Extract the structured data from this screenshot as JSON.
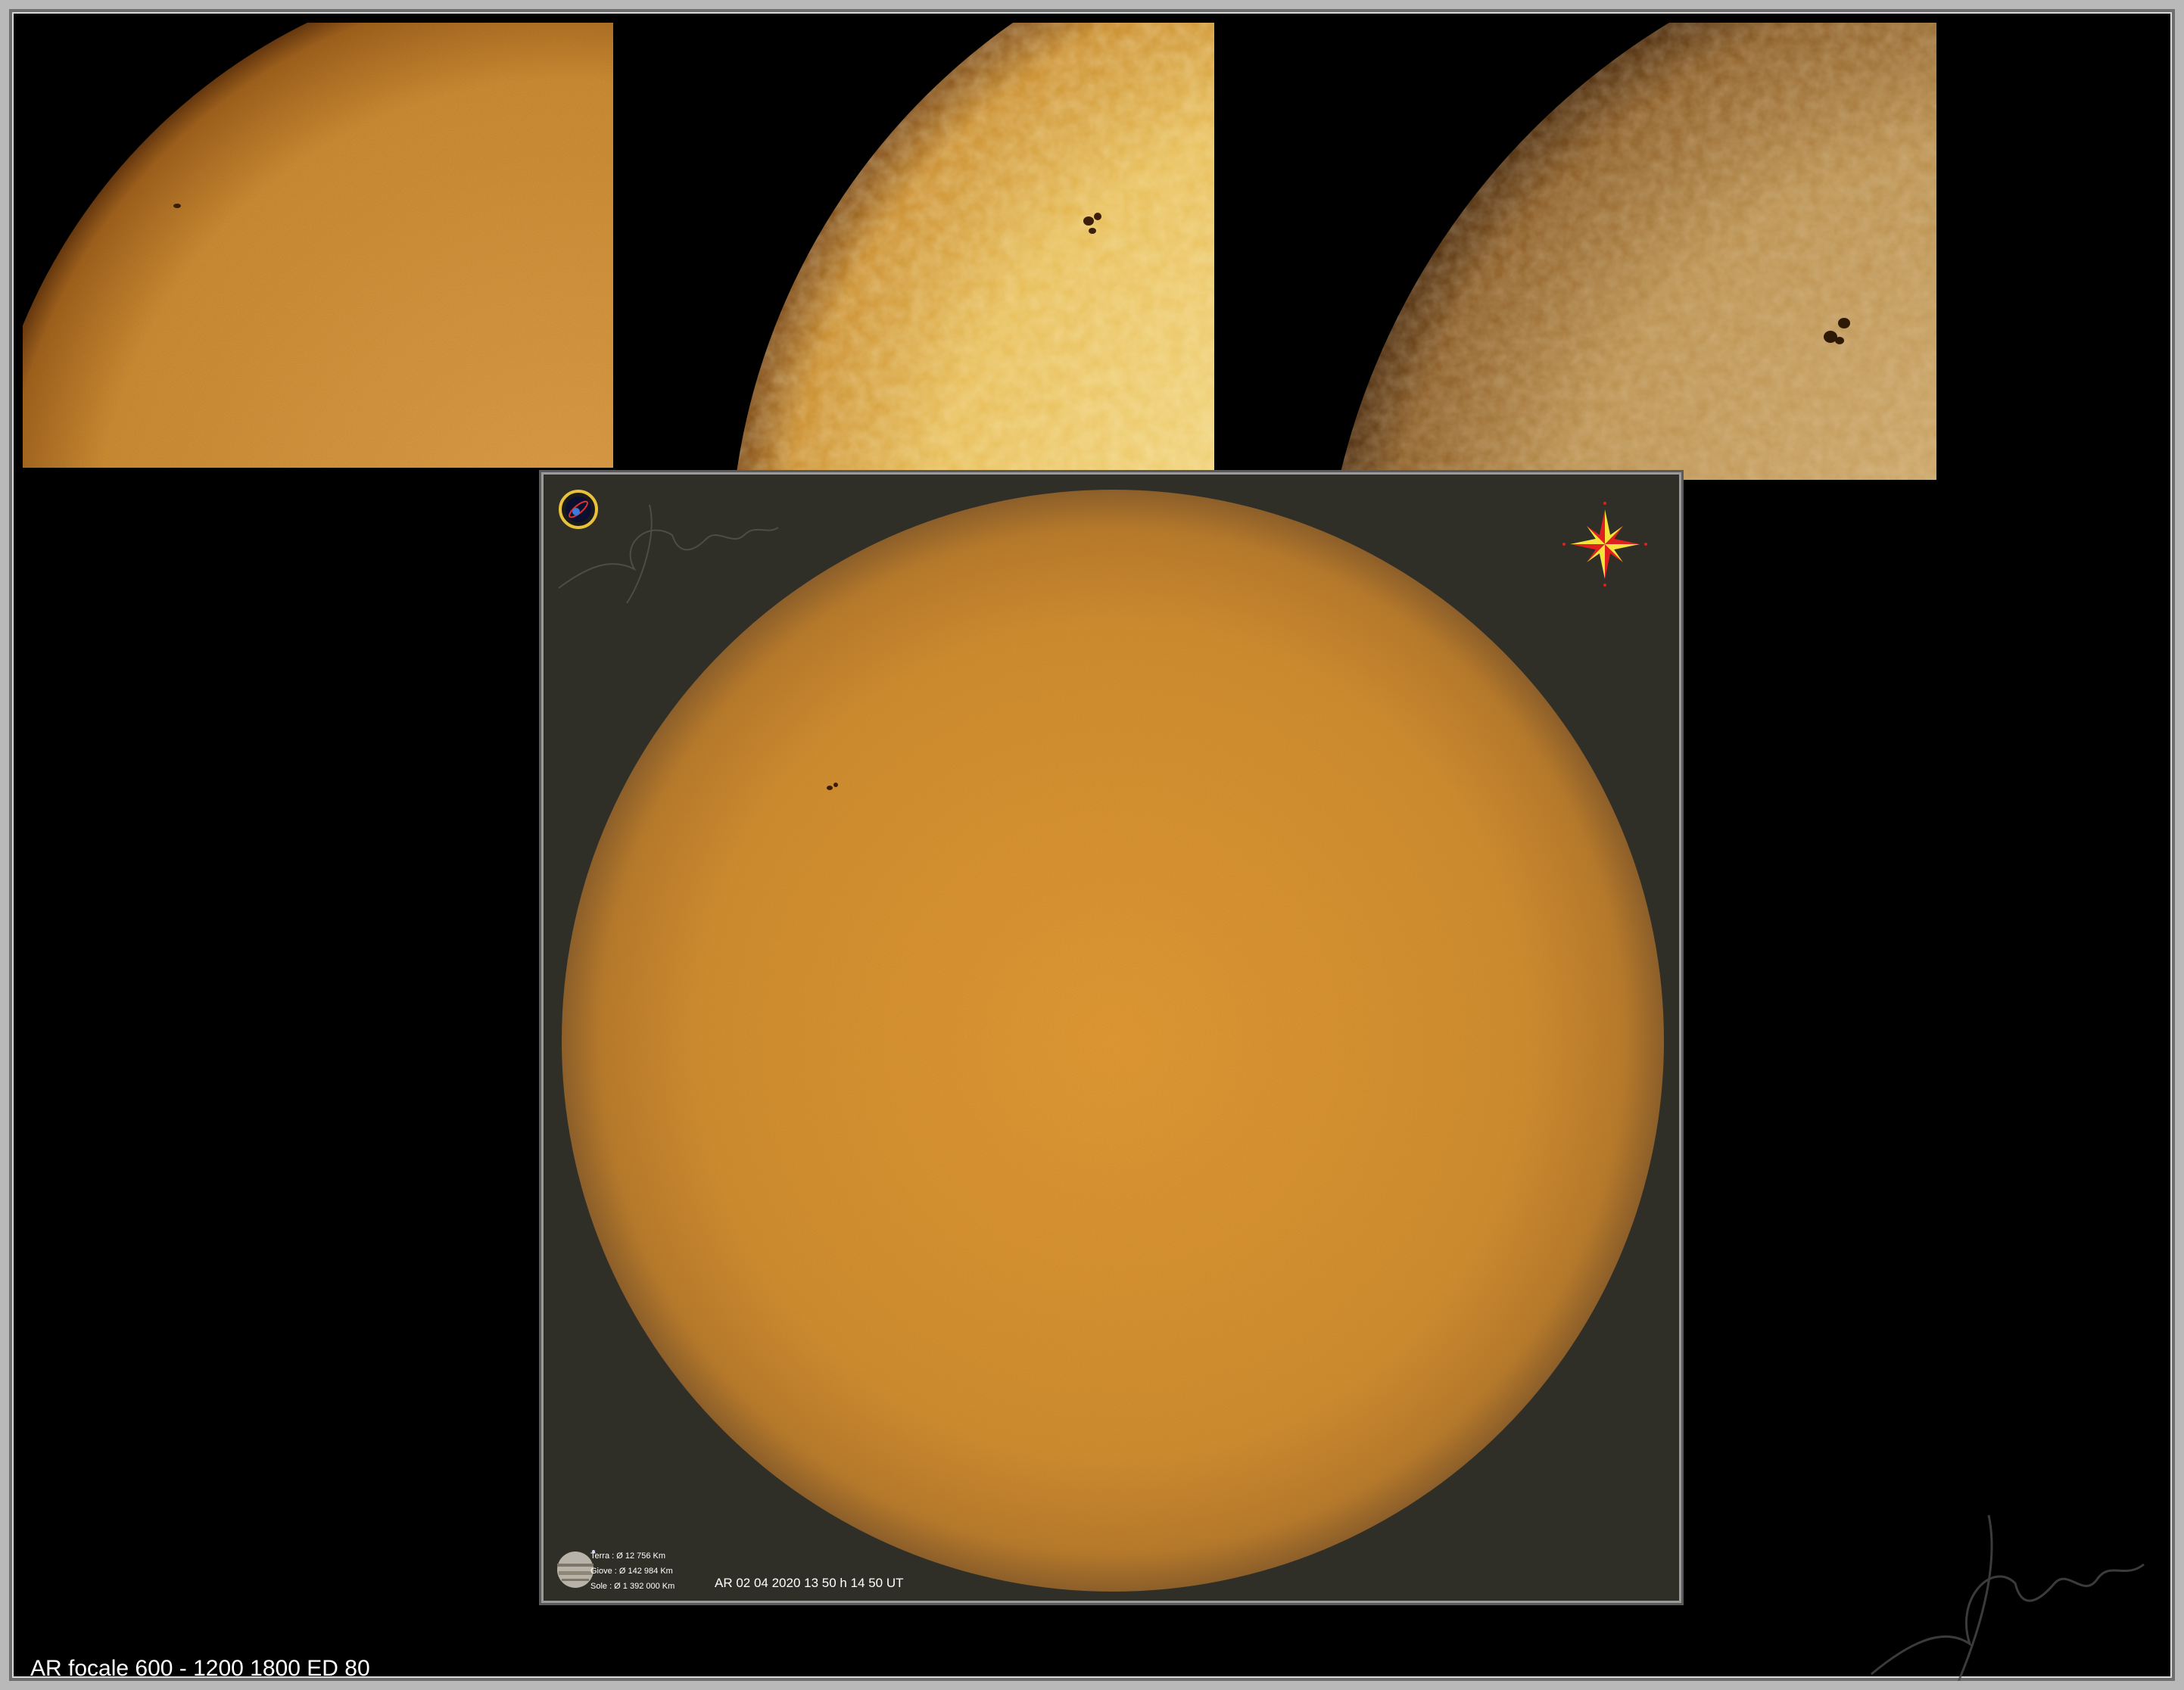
{
  "colors": {
    "background": "#000000",
    "frame": "#b9b9b9",
    "main_panel_bg": "#2f2f28",
    "sun_orange": "#d9902f",
    "sun_yellow": "#e8c05a",
    "sun_tan": "#b98e4c"
  },
  "images": [
    {
      "name": "sun-closeup-orange",
      "description_icon": "sun-disk-icon"
    },
    {
      "name": "sun-closeup-yellow",
      "description_icon": "sun-disk-icon"
    },
    {
      "name": "sun-closeup-tan",
      "description_icon": "sun-disk-icon"
    }
  ],
  "main_image": {
    "scale_labels": {
      "earth": "Terra : Ø 12 756 Km",
      "jupiter": "Giove : Ø 142 984 Km",
      "sun": "Sole :  Ø  1 392 000 Km"
    },
    "caption": "AR 02 04 2020 13 50 h 14 50 UT",
    "compass_icon": "compass-rose-icon",
    "logo_icon": "observatory-logo-icon",
    "planet_icon": "jupiter-icon"
  },
  "footer": {
    "caption": "AR focale 600 - 1200  1800  ED 80"
  }
}
